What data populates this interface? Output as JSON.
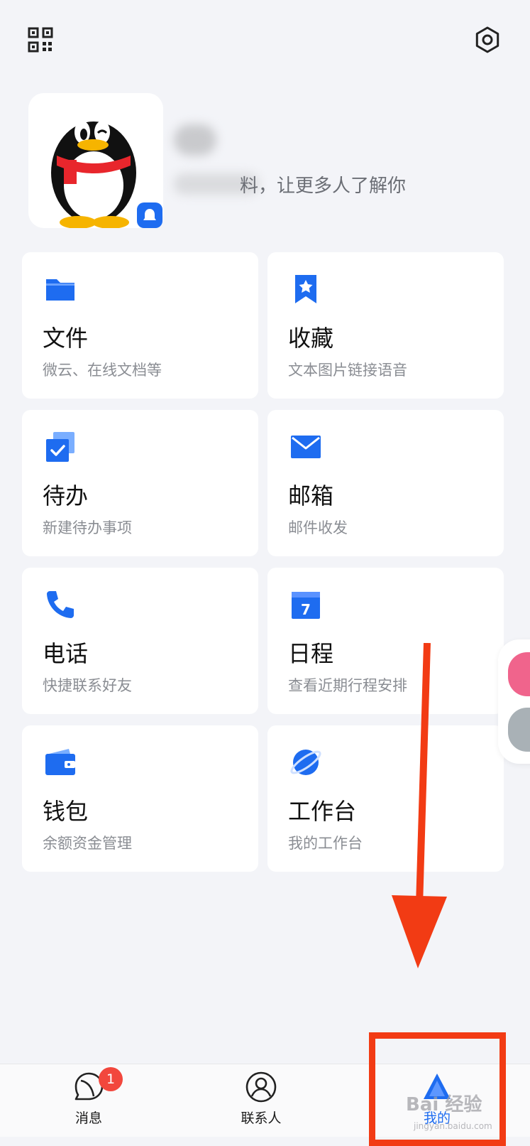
{
  "header": {
    "qr_icon": "qr-code-icon",
    "settings_icon": "gear-icon"
  },
  "profile": {
    "avatar_icon": "qq-penguin-avatar",
    "badge_icon": "qq-bell-icon",
    "bio_suffix": "料，让更多人了解你"
  },
  "grid": [
    {
      "title": "文件",
      "sub": "微云、在线文档等",
      "icon": "folder-icon"
    },
    {
      "title": "收藏",
      "sub": "文本图片链接语音",
      "icon": "bookmark-star-icon"
    },
    {
      "title": "待办",
      "sub": "新建待办事项",
      "icon": "todo-check-icon"
    },
    {
      "title": "邮箱",
      "sub": "邮件收发",
      "icon": "mail-icon"
    },
    {
      "title": "电话",
      "sub": "快捷联系好友",
      "icon": "phone-icon"
    },
    {
      "title": "日程",
      "sub": "查看近期行程安排",
      "icon": "calendar-icon"
    },
    {
      "title": "钱包",
      "sub": "余额资金管理",
      "icon": "wallet-icon"
    },
    {
      "title": "工作台",
      "sub": "我的工作台",
      "icon": "planet-icon"
    }
  ],
  "calendar_day": "7",
  "tabs": [
    {
      "label": "消息",
      "icon": "message-icon",
      "badge": "1"
    },
    {
      "label": "联系人",
      "icon": "contacts-icon"
    },
    {
      "label": "我的",
      "icon": "me-icon",
      "active": true
    }
  ],
  "watermark": {
    "text": "Bai 经验",
    "sub": "jingyan.baidu.com"
  },
  "colors": {
    "accent": "#1e6cf0",
    "annotation": "#f23b14",
    "badge": "#f2473d"
  }
}
